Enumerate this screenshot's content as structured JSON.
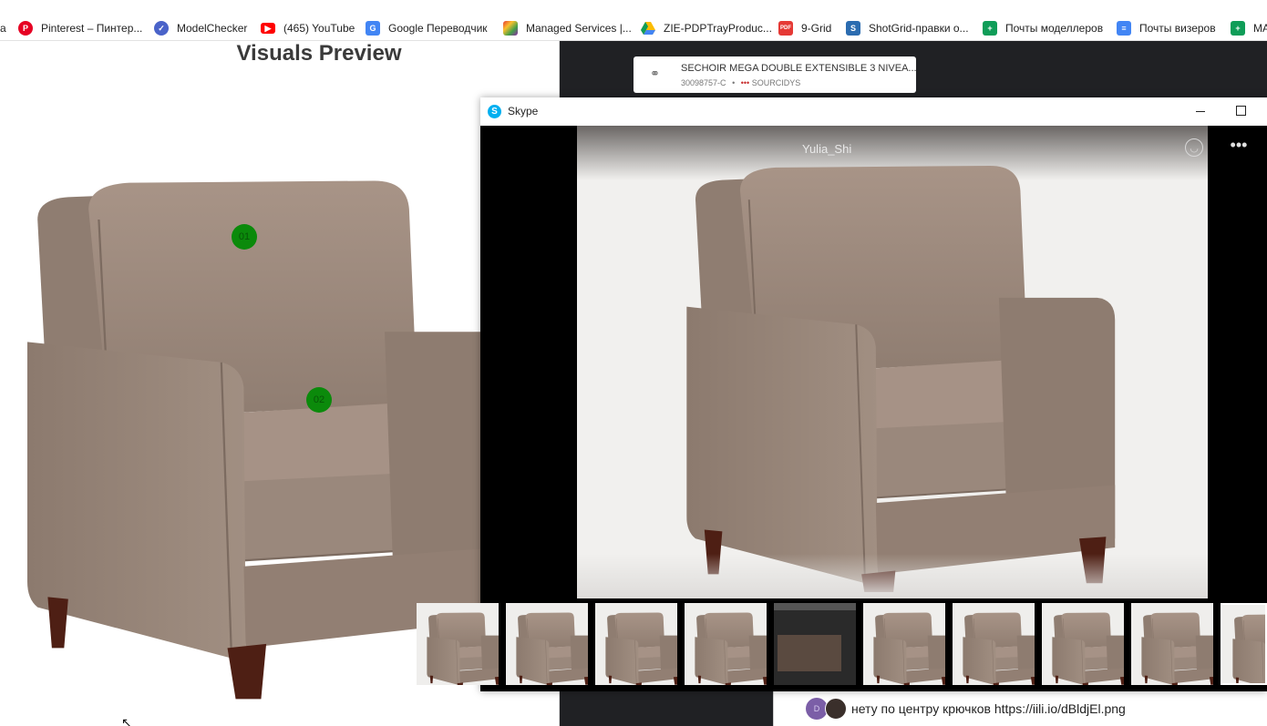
{
  "browser": {
    "bookmarks": [
      {
        "label": "a",
        "icon": "bookmark-fragment-icon"
      },
      {
        "label": "Pinterest – Пинтер...",
        "icon": "pinterest-icon"
      },
      {
        "label": "ModelChecker",
        "icon": "modelchecker-icon"
      },
      {
        "label": "(465) YouTube",
        "icon": "youtube-icon"
      },
      {
        "label": "Google Переводчик",
        "icon": "google-translate-icon"
      },
      {
        "label": "Managed Services |...",
        "icon": "managed-services-icon"
      },
      {
        "label": "ZIE-PDPTrayProduc...",
        "icon": "google-drive-icon"
      },
      {
        "label": "9-Grid",
        "icon": "pdf-icon"
      },
      {
        "label": "ShotGrid-правки о...",
        "icon": "shotgrid-icon"
      },
      {
        "label": "Почты моделлеров",
        "icon": "google-sheets-icon"
      },
      {
        "label": "Почты визеров",
        "icon": "google-docs-icon"
      },
      {
        "label": "MA",
        "icon": "google-sheets-icon"
      }
    ]
  },
  "visuals_preview": {
    "title": "Visuals Preview",
    "markers": [
      "01",
      "02"
    ]
  },
  "file_card": {
    "title": "SECHOIR MEGA DOUBLE EXTENSIBLE 3 NIVEA...",
    "code": "30098757-C",
    "separator": "•",
    "source": "SOURCIDYS"
  },
  "skype": {
    "window_title": "Skype",
    "sender": "Yulia_Shi",
    "thumbnail_count": 10,
    "selected_thumbnail": 9
  },
  "chat": {
    "message": "нету по центру крючков https://iili.io/dBldjEl.png"
  },
  "colors": {
    "marker_green": "#0b8a0b",
    "upholstery": "#9c8a7e",
    "leg_wood": "#4e1f14",
    "dark_bg": "#202124"
  }
}
